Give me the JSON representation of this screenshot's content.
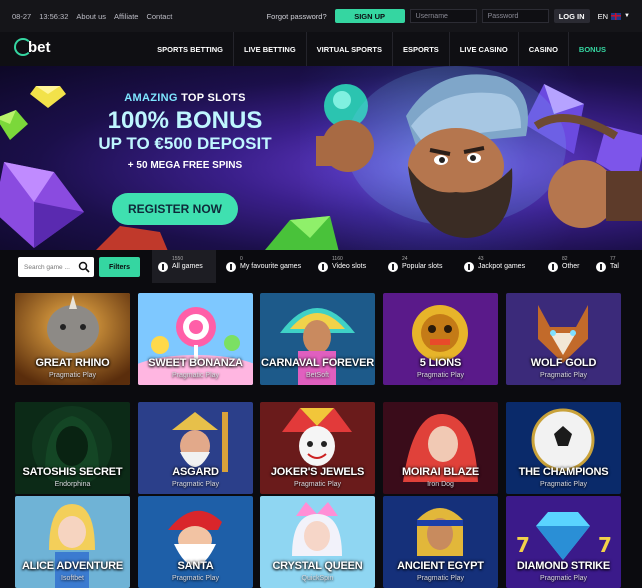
{
  "topbar": {
    "date": "08-27",
    "time": "13:56:32",
    "links": [
      "About us",
      "Affiliate",
      "Contact"
    ],
    "forgot": "Forgot password?",
    "signup": "SIGN UP",
    "username_placeholder": "Username",
    "password_placeholder": "Password",
    "login": "LOG IN",
    "lang": "EN"
  },
  "nav": {
    "logo": "bet",
    "items": [
      "SPORTS BETTING",
      "LIVE BETTING",
      "VIRTUAL SPORTS",
      "ESPORTS",
      "LIVE CASINO",
      "CASINO",
      "BONUS"
    ]
  },
  "hero": {
    "amazing": "AMAZING",
    "top_slots": "TOP SLOTS",
    "bonus_line1": "100% BONUS",
    "bonus_line2": "UP TO €500 DEPOSIT",
    "spins": "+ 50 MEGA FREE SPINS",
    "register": "REGISTER NOW"
  },
  "filter": {
    "search_placeholder": "Search game ...",
    "filters_label": "Filters",
    "categories": [
      {
        "label": "All games",
        "count": "1550"
      },
      {
        "label": "My favourite games",
        "count": "0"
      },
      {
        "label": "Video slots",
        "count": "1160"
      },
      {
        "label": "Popular slots",
        "count": "24"
      },
      {
        "label": "Jackpot games",
        "count": "43"
      },
      {
        "label": "Other",
        "count": "82"
      },
      {
        "label": "Tal",
        "count": "77"
      }
    ]
  },
  "games": [
    {
      "title": "GREAT RHINO",
      "provider": "Pragmatic Play"
    },
    {
      "title": "SWEET BONANZA",
      "provider": "Pragmatic Play"
    },
    {
      "title": "CARNAVAL FOREVER",
      "provider": "BetSoft"
    },
    {
      "title": "5 LIONS",
      "provider": "Pragmatic Play"
    },
    {
      "title": "WOLF GOLD",
      "provider": "Pragmatic Play"
    },
    {
      "title": "SATOSHIS SECRET",
      "provider": "Endorphina"
    },
    {
      "title": "ASGARD",
      "provider": "Pragmatic Play"
    },
    {
      "title": "JOKER'S JEWELS",
      "provider": "Pragmatic Play"
    },
    {
      "title": "MOIRAI BLAZE",
      "provider": "Iron Dog"
    },
    {
      "title": "THE CHAMPIONS",
      "provider": "Pragmatic Play"
    },
    {
      "title": "ALICE ADVENTURE",
      "provider": "Isoftbet"
    },
    {
      "title": "SANTA",
      "provider": "Pragmatic Play"
    },
    {
      "title": "CRYSTAL QUEEN",
      "provider": "QuickSpin"
    },
    {
      "title": "ANCIENT EGYPT",
      "provider": "Pragmatic Play"
    },
    {
      "title": "DIAMOND STRIKE",
      "provider": "Pragmatic Play"
    }
  ],
  "colors": {
    "accent": "#35d6a1",
    "bg": "#0b0b0f"
  }
}
